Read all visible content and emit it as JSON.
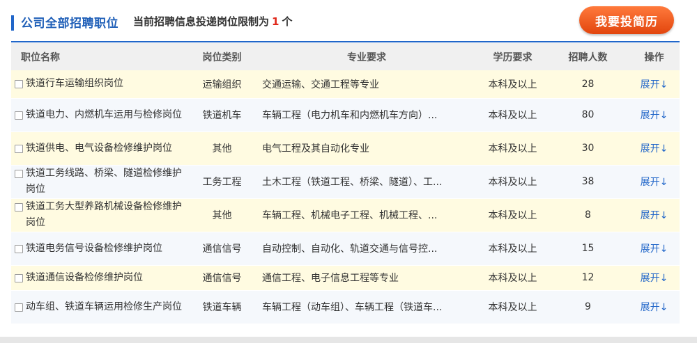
{
  "header": {
    "title": "公司全部招聘职位",
    "limit_prefix": "当前招聘信息投递岗位限制为",
    "limit_value": "1",
    "limit_suffix": "个",
    "apply_button": "我要投简历"
  },
  "table": {
    "columns": [
      "职位名称",
      "岗位类别",
      "专业要求",
      "学历要求",
      "招聘人数",
      "操作"
    ],
    "rows": [
      {
        "name": "铁道行车运输组织岗位",
        "category": "运输组织",
        "major": "交通运输、交通工程等专业",
        "education": "本科及以上",
        "count": "28",
        "action": "展开↓"
      },
      {
        "name": "铁道电力、内燃机车运用与检修岗位",
        "category": "铁道机车",
        "major": "车辆工程（电力机车和内燃机车方向）...",
        "education": "本科及以上",
        "count": "80",
        "action": "展开↓"
      },
      {
        "name": "铁道供电、电气设备检修维护岗位",
        "category": "其他",
        "major": "电气工程及其自动化专业",
        "education": "本科及以上",
        "count": "30",
        "action": "展开↓"
      },
      {
        "name": "铁道工务线路、桥梁、隧道检修维护岗位",
        "category": "工务工程",
        "major": "土木工程（铁道工程、桥梁、隧道）、工...",
        "education": "本科及以上",
        "count": "38",
        "action": "展开↓"
      },
      {
        "name": "铁道工务大型养路机械设备检修维护岗位",
        "category": "其他",
        "major": "车辆工程、机械电子工程、机械工程、...",
        "education": "本科及以上",
        "count": "8",
        "action": "展开↓"
      },
      {
        "name": "铁道电务信号设备检修维护岗位",
        "category": "通信信号",
        "major": "自动控制、自动化、轨道交通与信号控...",
        "education": "本科及以上",
        "count": "15",
        "action": "展开↓"
      },
      {
        "name": "铁道通信设备检修维护岗位",
        "category": "通信信号",
        "major": "通信工程、电子信息工程等专业",
        "education": "本科及以上",
        "count": "12",
        "action": "展开↓"
      },
      {
        "name": "动车组、铁道车辆运用检修生产岗位",
        "category": "铁道车辆",
        "major": "车辆工程（动车组）、车辆工程（铁道车...",
        "education": "本科及以上",
        "count": "9",
        "action": "展开↓"
      }
    ]
  },
  "colors": {
    "accent": "#2166c9",
    "highlight": "#e0271a",
    "button": "#e2450d",
    "row_odd": "#fffbe1",
    "row_even": "#f5f8fc"
  }
}
